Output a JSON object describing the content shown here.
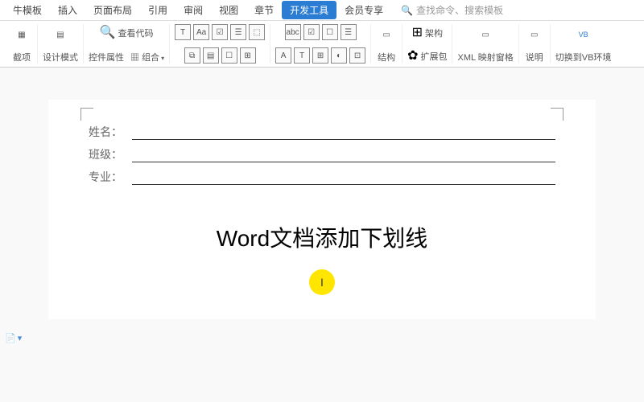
{
  "menu": {
    "items": [
      "牛模板",
      "插入",
      "页面布局",
      "引用",
      "审阅",
      "视图",
      "章节",
      "开发工具",
      "会员专享"
    ],
    "active_index": 7,
    "search_placeholder": "查找命令、搜索模板"
  },
  "toolbar": {
    "groups": [
      {
        "label": "截项",
        "icons": [
          "▦"
        ]
      },
      {
        "label": "设计模式",
        "icons": [
          "▤"
        ]
      },
      {
        "label_viewcode": "查看代码",
        "label_props": "控件属性",
        "label_combo": "组合",
        "icon_combo": "▦"
      },
      {
        "row1": [
          "T",
          "Aa",
          "☑",
          "☰",
          "⬚"
        ],
        "row2": [
          "⧉",
          "▤",
          "☐",
          "⊞"
        ]
      },
      {
        "row1": [
          "abc",
          "☑",
          "☐",
          "☰"
        ],
        "row2": [
          "A",
          "T",
          "⊞",
          "◐",
          "⊡"
        ]
      },
      {
        "label": "结构",
        "icons": [
          "▭"
        ]
      },
      {
        "label_struct": "架构",
        "label_ext": "扩展包",
        "icon1": "⊞",
        "icon2": "✿"
      },
      {
        "label": "XML 映射窗格",
        "icons": [
          "▭"
        ]
      },
      {
        "label": "说明",
        "icons": [
          "▭"
        ]
      },
      {
        "label": "切换到VB环境",
        "icons": [
          "VB"
        ]
      }
    ]
  },
  "document": {
    "fields": [
      {
        "label": "姓名："
      },
      {
        "label": "班级："
      },
      {
        "label": "专业："
      }
    ],
    "caption": "Word文档添加下划线",
    "cursor_glyph": "I"
  },
  "side_tag": "▸"
}
